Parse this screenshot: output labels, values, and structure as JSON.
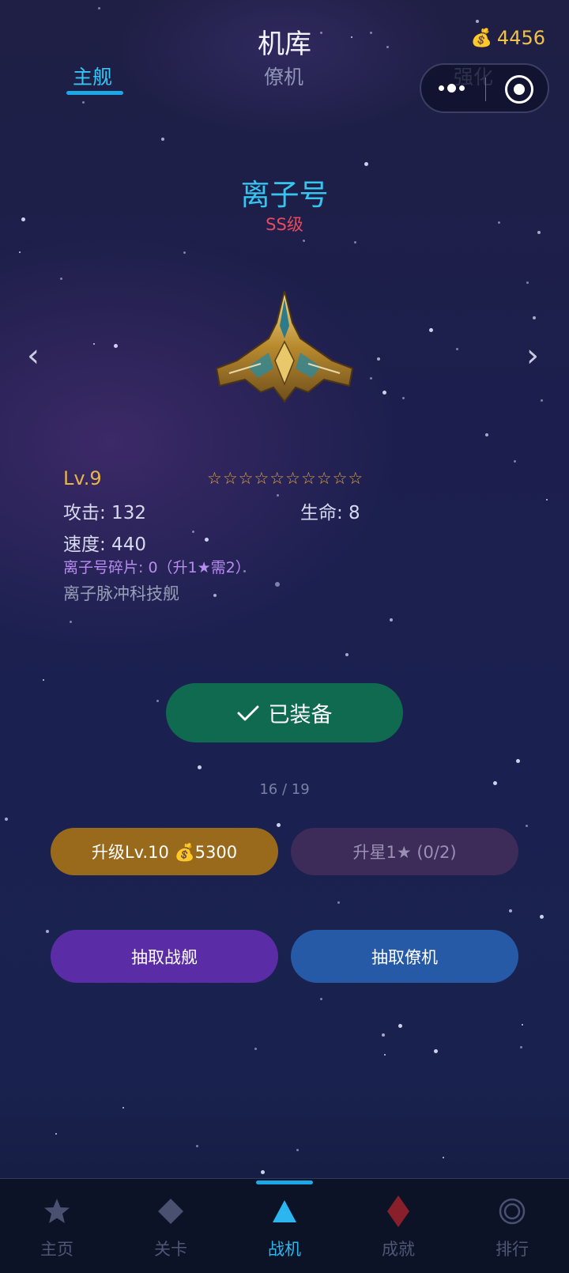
{
  "header": {
    "title": "机库",
    "coins": "4456",
    "coin_icon": "money-bag-icon"
  },
  "tabs": [
    {
      "label": "主舰",
      "active": true
    },
    {
      "label": "僚机",
      "active": false
    },
    {
      "label": "强化",
      "active": false
    }
  ],
  "ship": {
    "name": "离子号",
    "grade": "SS级",
    "level": "Lv.9",
    "stars": "☆☆☆☆☆☆☆☆☆☆",
    "attack": "攻击: 132",
    "health": "生命: 8",
    "speed": "速度: 440",
    "fragments": "离子号碎片: 0（升1★需2）",
    "description": "离子脉冲科技舰"
  },
  "nav_arrows": {
    "prev": "‹",
    "next": "›"
  },
  "equip_button": {
    "label": "已装备"
  },
  "pager": "16 / 19",
  "actions": {
    "upgrade": "升级Lv.10 💰5300",
    "star_up": "升星1★ (0/2)",
    "draw_ship": "抽取战舰",
    "draw_drone": "抽取僚机"
  },
  "bottom_nav": [
    {
      "label": "主页",
      "icon": "star-icon"
    },
    {
      "label": "关卡",
      "icon": "diamond-icon"
    },
    {
      "label": "战机",
      "icon": "triangle-icon",
      "active": true
    },
    {
      "label": "成就",
      "icon": "red-diamond-icon"
    },
    {
      "label": "排行",
      "icon": "ring-icon"
    }
  ],
  "colors": {
    "accent": "#35c6f0",
    "gold": "#e7b54a",
    "grade_red": "#e84a5f",
    "equip_green": "#0f6a4f",
    "upgrade_gold": "#9a6a1c",
    "draw_purple": "#5a2ca6",
    "draw_blue": "#275aa6"
  }
}
